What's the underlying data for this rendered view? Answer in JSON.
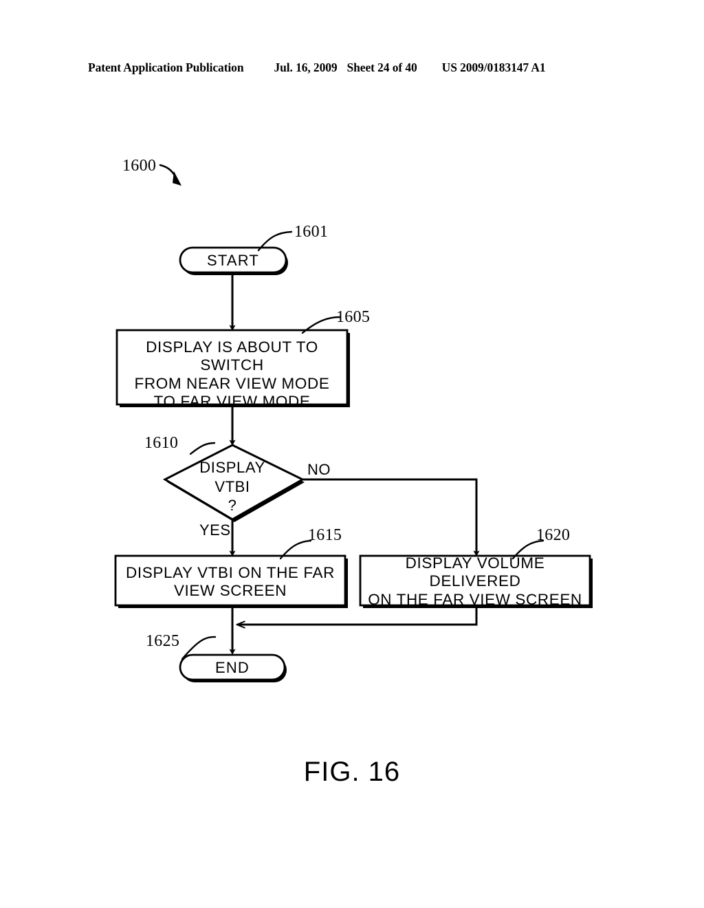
{
  "header": {
    "publication": "Patent Application Publication",
    "date": "Jul. 16, 2009",
    "sheet": "Sheet 24 of 40",
    "patent_number": "US 2009/0183147 A1"
  },
  "figure": {
    "caption": "FIG. 16",
    "diagram_ref": "1600",
    "nodes": [
      {
        "id": "start",
        "ref": "1601",
        "shape": "terminator",
        "text": "START"
      },
      {
        "id": "switch_notice",
        "ref": "1605",
        "shape": "process",
        "text": "DISPLAY IS ABOUT TO SWITCH\nFROM NEAR VIEW MODE\nTO FAR VIEW MODE"
      },
      {
        "id": "decision_vtbi",
        "ref": "1610",
        "shape": "decision",
        "text": "DISPLAY\nVTBI\n?"
      },
      {
        "id": "display_vtbi",
        "ref": "1615",
        "shape": "process",
        "text": "DISPLAY VTBI ON  THE  FAR\nVIEW  SCREEN"
      },
      {
        "id": "display_volume",
        "ref": "1620",
        "shape": "process",
        "text": "DISPLAY VOLUME DELIVERED\nON THE FAR VIEW SCREEN"
      },
      {
        "id": "end",
        "ref": "1625",
        "shape": "terminator",
        "text": "END"
      }
    ],
    "branch_labels": {
      "yes": "YES",
      "no": "NO"
    }
  }
}
